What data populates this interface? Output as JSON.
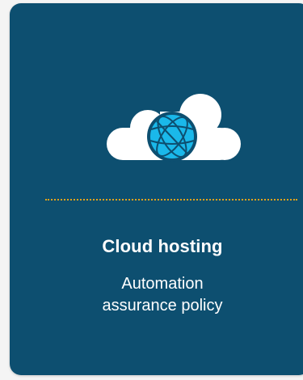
{
  "card": {
    "icon": "cloud-globe-icon",
    "title": "Cloud hosting",
    "subtitle_lines": [
      "Automation",
      "assurance policy"
    ]
  },
  "colors": {
    "card_background": "#0d4f70",
    "page_background": "#f4f4f4",
    "divider": "#e3a21a",
    "globe": "#1ab8ea",
    "text": "#ffffff"
  }
}
